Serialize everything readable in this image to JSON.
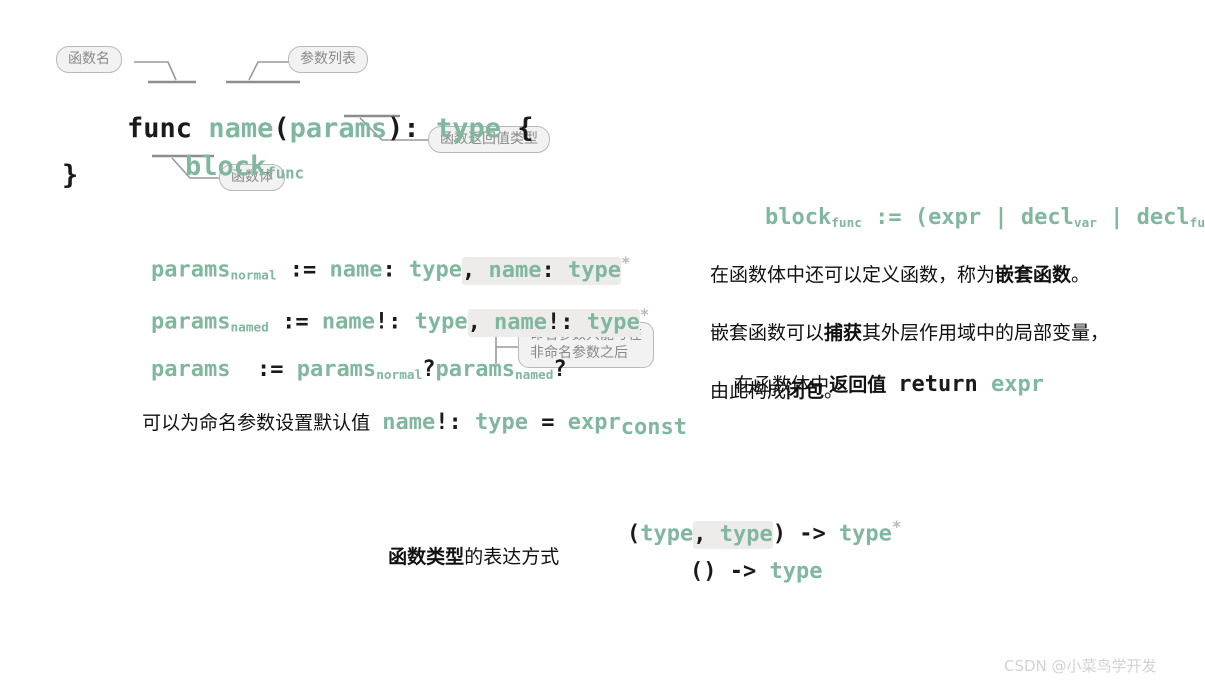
{
  "signature": {
    "kw_func": "func ",
    "name": "name",
    "paren_open": "(",
    "params": "params",
    "paren_close": ")",
    "colon": ": ",
    "type": "type",
    "brace_open": " {",
    "block": "block",
    "block_sub": "func",
    "brace_close": "}"
  },
  "callouts": {
    "func_name": "函数名",
    "param_list": "参数列表",
    "return_type": "函数返回值类型",
    "func_body": "函数体",
    "named_param_note": "命名参数只能写在\n非命名参数之后"
  },
  "grammar": {
    "row1": {
      "lhs": "params",
      "lhs_sub": "normal",
      "op": " := ",
      "a_name": "name",
      "a_colon": ": ",
      "a_type": "type",
      "comma": ",",
      "b_name": " name",
      "b_colon": ": ",
      "b_type": "type",
      "star": "*"
    },
    "row2": {
      "lhs": "params",
      "lhs_sub": "named",
      "op": " := ",
      "a_name": "name",
      "a_bang": "!",
      "a_colon": ": ",
      "a_type": "type",
      "comma": ",",
      "b_name": " name",
      "b_bang": "!",
      "b_colon": ": ",
      "b_type": "type",
      "star": "*"
    },
    "row3": {
      "lhs": "params",
      "op": "  := ",
      "a": "params",
      "a_sub": "normal",
      "q1": "?",
      "b": "params",
      "b_sub": "named",
      "q2": "?"
    }
  },
  "default_value": {
    "text": "可以为命名参数设置默认值  ",
    "name": "name",
    "bang": "!",
    "colon": ": ",
    "type": "type",
    "eq": " = ",
    "expr": "expr",
    "expr_sub": "const"
  },
  "right_column": {
    "block_rule": {
      "lhs": "block",
      "lhs_sub": "func",
      "op": " := ",
      "paren_open": "(",
      "expr": "expr",
      "bar1": " | ",
      "decl_var": "decl",
      "decl_var_sub": "var",
      "bar2": " | ",
      "decl_func": "decl",
      "decl_func_sub": "func",
      "paren_close": ")",
      "star": "*"
    },
    "paragraph": {
      "l1_a": "在函数体中还可以定义函数，称为",
      "l1_b": "嵌套函数",
      "l1_c": "。",
      "l2_a": "嵌套函数可以",
      "l2_b": "捕获",
      "l2_c": "其外层作用域中的局部变量，",
      "l3_a": "由此构成",
      "l3_b": "闭包",
      "l3_c": "。"
    },
    "return_line": {
      "prefix": "在函数体中",
      "bold": "返回值",
      "spacer": "  ",
      "kw": "return",
      "space": " ",
      "expr": "expr"
    }
  },
  "function_type": {
    "label_bold": "函数类型",
    "label_rest": "的表达方式",
    "row1": {
      "paren_open": "(",
      "t1": "type",
      "comma": ",",
      "t2": " type",
      "paren_close": ")",
      "arrow": " -> ",
      "t3": "type",
      "star": "*"
    },
    "row2": {
      "parens": "()",
      "arrow": " -> ",
      "t": "type"
    }
  },
  "watermark": "CSDN @小菜鸟学开发",
  "colors": {
    "teal": "#7fb79f",
    "ink": "#1a1a1a",
    "pill_border": "#b9b9b9",
    "pill_fill": "#f2f2f2",
    "pill_text": "#8a8a8a",
    "highlight": "#eeecea",
    "star": "#b9b9b9",
    "watermark": "#d2d2d2"
  }
}
